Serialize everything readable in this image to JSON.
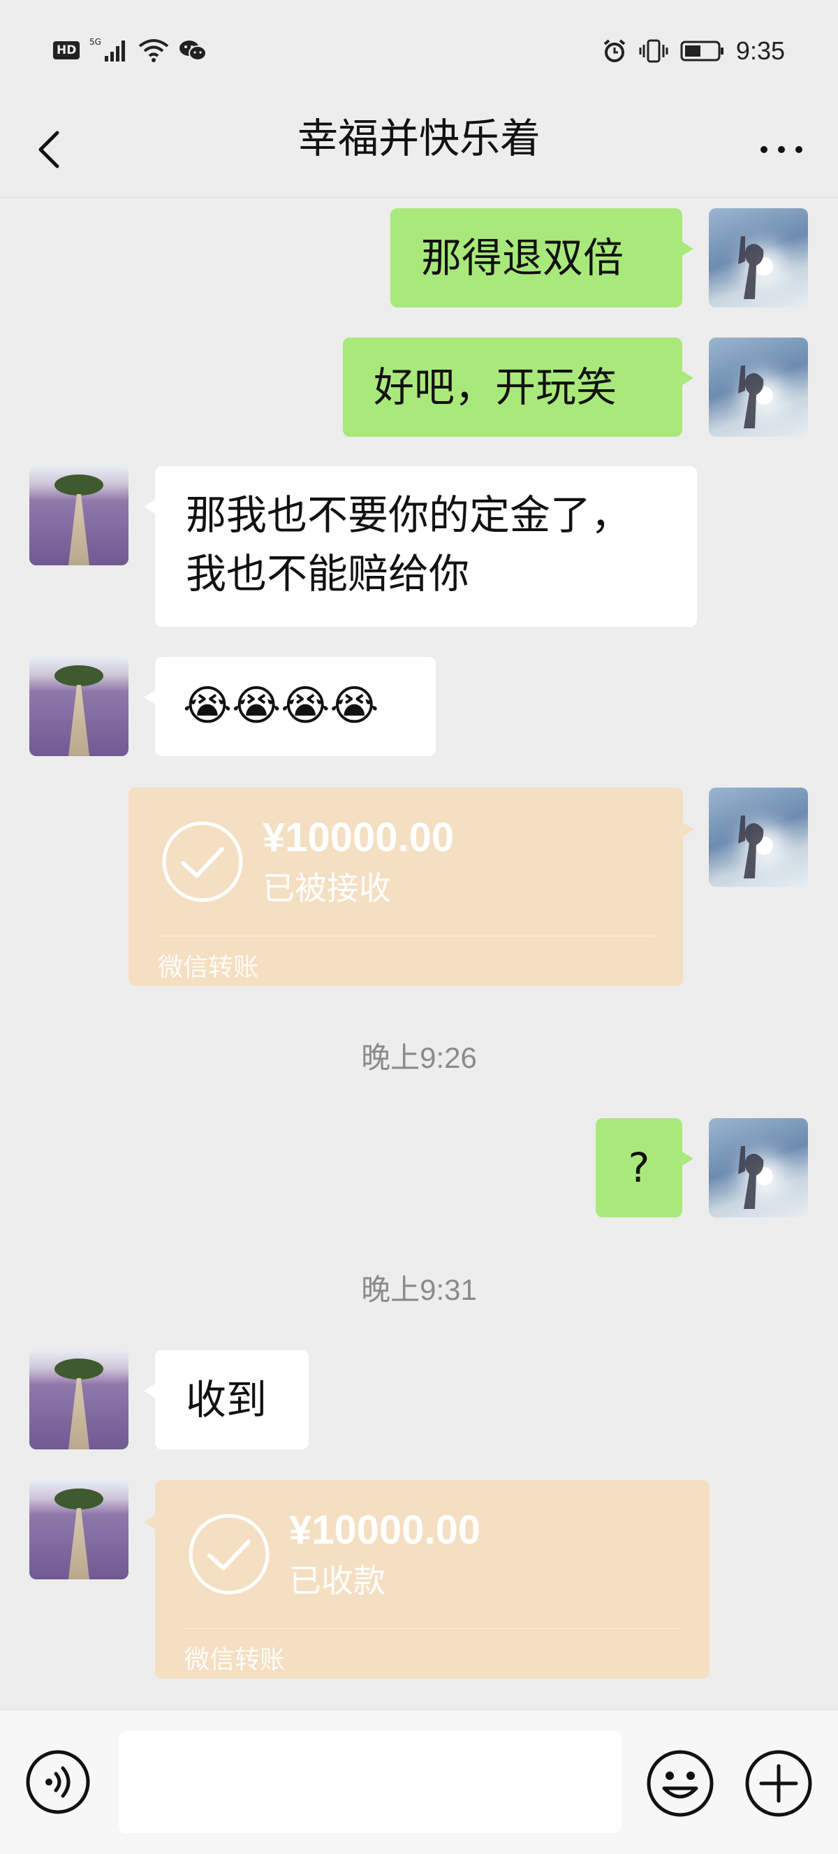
{
  "status_bar": {
    "network_badge": "HD",
    "network_type": "5G",
    "time": "9:35",
    "icons": [
      "signal-icon",
      "wifi-icon",
      "wechat-icon",
      "alarm-icon",
      "vibrate-icon",
      "battery-icon"
    ]
  },
  "header": {
    "title": "幸福并快乐着",
    "back_icon": "chevron-left-icon",
    "more_icon": "more-icon"
  },
  "messages": [
    {
      "sender": "self",
      "text": "那得退双倍"
    },
    {
      "sender": "self",
      "text": "好吧，开玩笑"
    },
    {
      "sender": "other",
      "text_line1": "那我也不要你的定金了，",
      "text_line2": "我也不能赔给你"
    },
    {
      "sender": "other",
      "emoji": "😭😭😭😭"
    },
    {
      "sender": "self",
      "type": "transfer",
      "amount": "¥10000.00",
      "status": "已被接收",
      "brand": "微信转账"
    },
    {
      "type": "time",
      "text": "晚上9:26"
    },
    {
      "sender": "self",
      "text": "?"
    },
    {
      "type": "time",
      "text": "晚上9:31"
    },
    {
      "sender": "other",
      "text": "收到"
    },
    {
      "sender": "other",
      "type": "transfer",
      "amount": "¥10000.00",
      "status": "已收款",
      "brand": "微信转账"
    }
  ],
  "input_bar": {
    "voice_icon": "voice-icon",
    "emoji_icon": "emoji-icon",
    "plus_icon": "plus-icon"
  },
  "colors": {
    "self_bubble": "#a9e97b",
    "other_bubble": "#ffffff",
    "transfer_card": "#f5dfc2",
    "background": "#ededed"
  }
}
